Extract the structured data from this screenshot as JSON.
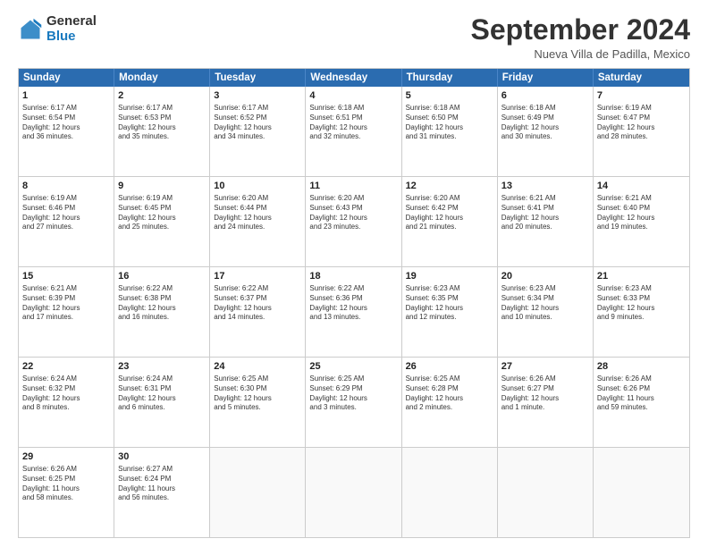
{
  "header": {
    "logo_general": "General",
    "logo_blue": "Blue",
    "month_title": "September 2024",
    "location": "Nueva Villa de Padilla, Mexico"
  },
  "weekdays": [
    "Sunday",
    "Monday",
    "Tuesday",
    "Wednesday",
    "Thursday",
    "Friday",
    "Saturday"
  ],
  "rows": [
    [
      {
        "day": "1",
        "lines": [
          "Sunrise: 6:17 AM",
          "Sunset: 6:54 PM",
          "Daylight: 12 hours",
          "and 36 minutes."
        ]
      },
      {
        "day": "2",
        "lines": [
          "Sunrise: 6:17 AM",
          "Sunset: 6:53 PM",
          "Daylight: 12 hours",
          "and 35 minutes."
        ]
      },
      {
        "day": "3",
        "lines": [
          "Sunrise: 6:17 AM",
          "Sunset: 6:52 PM",
          "Daylight: 12 hours",
          "and 34 minutes."
        ]
      },
      {
        "day": "4",
        "lines": [
          "Sunrise: 6:18 AM",
          "Sunset: 6:51 PM",
          "Daylight: 12 hours",
          "and 32 minutes."
        ]
      },
      {
        "day": "5",
        "lines": [
          "Sunrise: 6:18 AM",
          "Sunset: 6:50 PM",
          "Daylight: 12 hours",
          "and 31 minutes."
        ]
      },
      {
        "day": "6",
        "lines": [
          "Sunrise: 6:18 AM",
          "Sunset: 6:49 PM",
          "Daylight: 12 hours",
          "and 30 minutes."
        ]
      },
      {
        "day": "7",
        "lines": [
          "Sunrise: 6:19 AM",
          "Sunset: 6:47 PM",
          "Daylight: 12 hours",
          "and 28 minutes."
        ]
      }
    ],
    [
      {
        "day": "8",
        "lines": [
          "Sunrise: 6:19 AM",
          "Sunset: 6:46 PM",
          "Daylight: 12 hours",
          "and 27 minutes."
        ]
      },
      {
        "day": "9",
        "lines": [
          "Sunrise: 6:19 AM",
          "Sunset: 6:45 PM",
          "Daylight: 12 hours",
          "and 25 minutes."
        ]
      },
      {
        "day": "10",
        "lines": [
          "Sunrise: 6:20 AM",
          "Sunset: 6:44 PM",
          "Daylight: 12 hours",
          "and 24 minutes."
        ]
      },
      {
        "day": "11",
        "lines": [
          "Sunrise: 6:20 AM",
          "Sunset: 6:43 PM",
          "Daylight: 12 hours",
          "and 23 minutes."
        ]
      },
      {
        "day": "12",
        "lines": [
          "Sunrise: 6:20 AM",
          "Sunset: 6:42 PM",
          "Daylight: 12 hours",
          "and 21 minutes."
        ]
      },
      {
        "day": "13",
        "lines": [
          "Sunrise: 6:21 AM",
          "Sunset: 6:41 PM",
          "Daylight: 12 hours",
          "and 20 minutes."
        ]
      },
      {
        "day": "14",
        "lines": [
          "Sunrise: 6:21 AM",
          "Sunset: 6:40 PM",
          "Daylight: 12 hours",
          "and 19 minutes."
        ]
      }
    ],
    [
      {
        "day": "15",
        "lines": [
          "Sunrise: 6:21 AM",
          "Sunset: 6:39 PM",
          "Daylight: 12 hours",
          "and 17 minutes."
        ]
      },
      {
        "day": "16",
        "lines": [
          "Sunrise: 6:22 AM",
          "Sunset: 6:38 PM",
          "Daylight: 12 hours",
          "and 16 minutes."
        ]
      },
      {
        "day": "17",
        "lines": [
          "Sunrise: 6:22 AM",
          "Sunset: 6:37 PM",
          "Daylight: 12 hours",
          "and 14 minutes."
        ]
      },
      {
        "day": "18",
        "lines": [
          "Sunrise: 6:22 AM",
          "Sunset: 6:36 PM",
          "Daylight: 12 hours",
          "and 13 minutes."
        ]
      },
      {
        "day": "19",
        "lines": [
          "Sunrise: 6:23 AM",
          "Sunset: 6:35 PM",
          "Daylight: 12 hours",
          "and 12 minutes."
        ]
      },
      {
        "day": "20",
        "lines": [
          "Sunrise: 6:23 AM",
          "Sunset: 6:34 PM",
          "Daylight: 12 hours",
          "and 10 minutes."
        ]
      },
      {
        "day": "21",
        "lines": [
          "Sunrise: 6:23 AM",
          "Sunset: 6:33 PM",
          "Daylight: 12 hours",
          "and 9 minutes."
        ]
      }
    ],
    [
      {
        "day": "22",
        "lines": [
          "Sunrise: 6:24 AM",
          "Sunset: 6:32 PM",
          "Daylight: 12 hours",
          "and 8 minutes."
        ]
      },
      {
        "day": "23",
        "lines": [
          "Sunrise: 6:24 AM",
          "Sunset: 6:31 PM",
          "Daylight: 12 hours",
          "and 6 minutes."
        ]
      },
      {
        "day": "24",
        "lines": [
          "Sunrise: 6:25 AM",
          "Sunset: 6:30 PM",
          "Daylight: 12 hours",
          "and 5 minutes."
        ]
      },
      {
        "day": "25",
        "lines": [
          "Sunrise: 6:25 AM",
          "Sunset: 6:29 PM",
          "Daylight: 12 hours",
          "and 3 minutes."
        ]
      },
      {
        "day": "26",
        "lines": [
          "Sunrise: 6:25 AM",
          "Sunset: 6:28 PM",
          "Daylight: 12 hours",
          "and 2 minutes."
        ]
      },
      {
        "day": "27",
        "lines": [
          "Sunrise: 6:26 AM",
          "Sunset: 6:27 PM",
          "Daylight: 12 hours",
          "and 1 minute."
        ]
      },
      {
        "day": "28",
        "lines": [
          "Sunrise: 6:26 AM",
          "Sunset: 6:26 PM",
          "Daylight: 11 hours",
          "and 59 minutes."
        ]
      }
    ],
    [
      {
        "day": "29",
        "lines": [
          "Sunrise: 6:26 AM",
          "Sunset: 6:25 PM",
          "Daylight: 11 hours",
          "and 58 minutes."
        ]
      },
      {
        "day": "30",
        "lines": [
          "Sunrise: 6:27 AM",
          "Sunset: 6:24 PM",
          "Daylight: 11 hours",
          "and 56 minutes."
        ]
      },
      {
        "day": "",
        "lines": []
      },
      {
        "day": "",
        "lines": []
      },
      {
        "day": "",
        "lines": []
      },
      {
        "day": "",
        "lines": []
      },
      {
        "day": "",
        "lines": []
      }
    ]
  ]
}
